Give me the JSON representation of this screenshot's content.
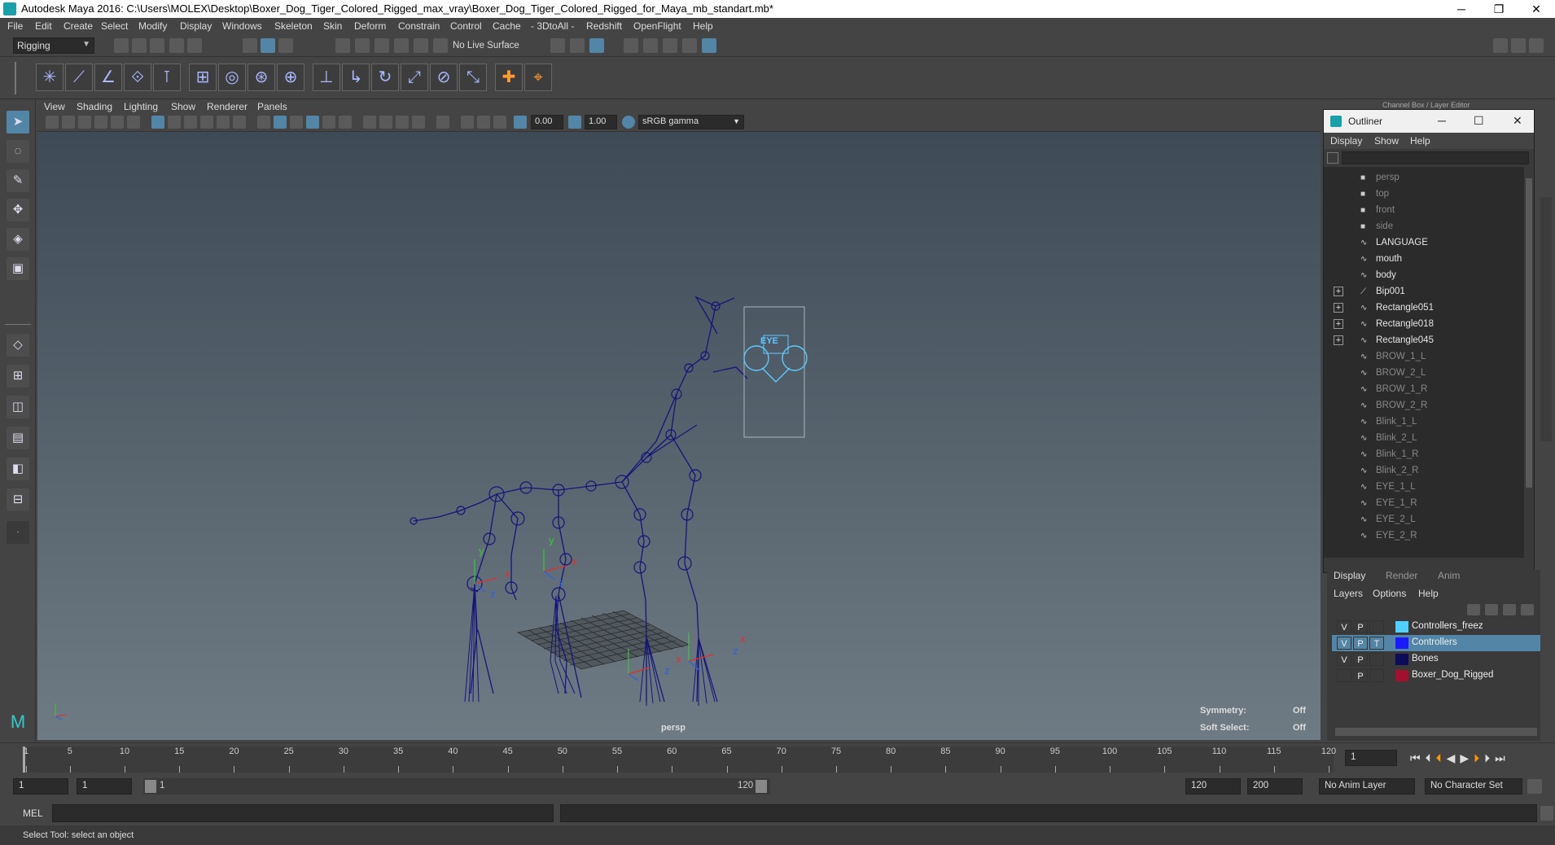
{
  "window": {
    "title": "Autodesk Maya 2016: C:\\Users\\MOLEX\\Desktop\\Boxer_Dog_Tiger_Colored_Rigged_max_vray\\Boxer_Dog_Tiger_Colored_Rigged_for_Maya_mb_standart.mb*",
    "minimize": "─",
    "restore": "❐",
    "close": "✕"
  },
  "menubar": [
    "File",
    "Edit",
    "Create",
    "Select",
    "Modify",
    "Display",
    "Windows",
    "Skeleton",
    "Skin",
    "Deform",
    "Constrain",
    "Control",
    "Cache",
    "- 3DtoAll -",
    "Redshift",
    "OpenFlight",
    "Help"
  ],
  "status": {
    "mode": "Rigging",
    "live_surface": "No Live Surface"
  },
  "panel": {
    "menu": [
      "View",
      "Shading",
      "Lighting",
      "Show",
      "Renderer",
      "Panels"
    ],
    "near_value": "0.00",
    "far_value": "1.00",
    "color_space": "sRGB gamma"
  },
  "viewport": {
    "camera_label": "persp",
    "symmetry_label": "Symmetry:",
    "symmetry_value": "Off",
    "softselect_label": "Soft Select:",
    "softselect_value": "Off",
    "controller_label": "EYE",
    "axis_x": "x",
    "axis_y": "y",
    "axis_z": "z",
    "wire_color": "#15157a",
    "controller_color": "#5ec8ff"
  },
  "channelbox_header": "Channel Box / Layer Editor",
  "outliner": {
    "title": "Outliner",
    "menu": [
      "Display",
      "Show",
      "Help"
    ],
    "items": [
      {
        "name": "persp",
        "type": "camera",
        "dim": true,
        "expand": false
      },
      {
        "name": "top",
        "type": "camera",
        "dim": true,
        "expand": false
      },
      {
        "name": "front",
        "type": "camera",
        "dim": true,
        "expand": false
      },
      {
        "name": "side",
        "type": "camera",
        "dim": true,
        "expand": false
      },
      {
        "name": "LANGUAGE",
        "type": "curve",
        "dim": false,
        "expand": false
      },
      {
        "name": "mouth",
        "type": "curve",
        "dim": false,
        "expand": false
      },
      {
        "name": "body",
        "type": "curve",
        "dim": false,
        "expand": false
      },
      {
        "name": "Bip001",
        "type": "joint",
        "dim": false,
        "expand": true
      },
      {
        "name": "Rectangle051",
        "type": "curve",
        "dim": false,
        "expand": true
      },
      {
        "name": "Rectangle018",
        "type": "curve",
        "dim": false,
        "expand": true
      },
      {
        "name": "Rectangle045",
        "type": "curve",
        "dim": false,
        "expand": true
      },
      {
        "name": "BROW_1_L",
        "type": "curve",
        "dim": true,
        "expand": false
      },
      {
        "name": "BROW_2_L",
        "type": "curve",
        "dim": true,
        "expand": false
      },
      {
        "name": "BROW_1_R",
        "type": "curve",
        "dim": true,
        "expand": false
      },
      {
        "name": "BROW_2_R",
        "type": "curve",
        "dim": true,
        "expand": false
      },
      {
        "name": "Blink_1_L",
        "type": "curve",
        "dim": true,
        "expand": false
      },
      {
        "name": "Blink_2_L",
        "type": "curve",
        "dim": true,
        "expand": false
      },
      {
        "name": "Blink_1_R",
        "type": "curve",
        "dim": true,
        "expand": false
      },
      {
        "name": "Blink_2_R",
        "type": "curve",
        "dim": true,
        "expand": false
      },
      {
        "name": "EYE_1_L",
        "type": "curve",
        "dim": true,
        "expand": false
      },
      {
        "name": "EYE_1_R",
        "type": "curve",
        "dim": true,
        "expand": false
      },
      {
        "name": "EYE_2_L",
        "type": "curve",
        "dim": true,
        "expand": false
      },
      {
        "name": "EYE_2_R",
        "type": "curve",
        "dim": true,
        "expand": false
      }
    ]
  },
  "layers": {
    "tabs": [
      "Display",
      "Render",
      "Anim"
    ],
    "menu": [
      "Layers",
      "Options",
      "Help"
    ],
    "rows": [
      {
        "v": "V",
        "p": "P",
        "t": "",
        "name": "Controllers_freez",
        "color": "#4fd0ff",
        "selected": false
      },
      {
        "v": "V",
        "p": "P",
        "t": "T",
        "name": "Controllers",
        "color": "#1a1aff",
        "selected": true
      },
      {
        "v": "V",
        "p": "P",
        "t": "",
        "name": "Bones",
        "color": "#0c0c5a",
        "selected": false
      },
      {
        "v": "",
        "p": "P",
        "t": "",
        "name": "Boxer_Dog_Rigged",
        "color": "#a3102e",
        "selected": false
      }
    ]
  },
  "timeline": {
    "ticks": [
      "1",
      "5",
      "10",
      "15",
      "20",
      "25",
      "30",
      "35",
      "40",
      "45",
      "50",
      "55",
      "60",
      "65",
      "70",
      "75",
      "80",
      "85",
      "90",
      "95",
      "100",
      "105",
      "110",
      "115",
      "120"
    ],
    "current_frame": "1"
  },
  "range": {
    "start": "1",
    "playback_start": "1",
    "slider_start": "1",
    "slider_end": "120",
    "playback_end": "120",
    "end": "200",
    "anim_layer": "No Anim Layer",
    "char_set": "No Character Set"
  },
  "cmd": {
    "lang": "MEL"
  },
  "help_text": "Select Tool: select an object"
}
